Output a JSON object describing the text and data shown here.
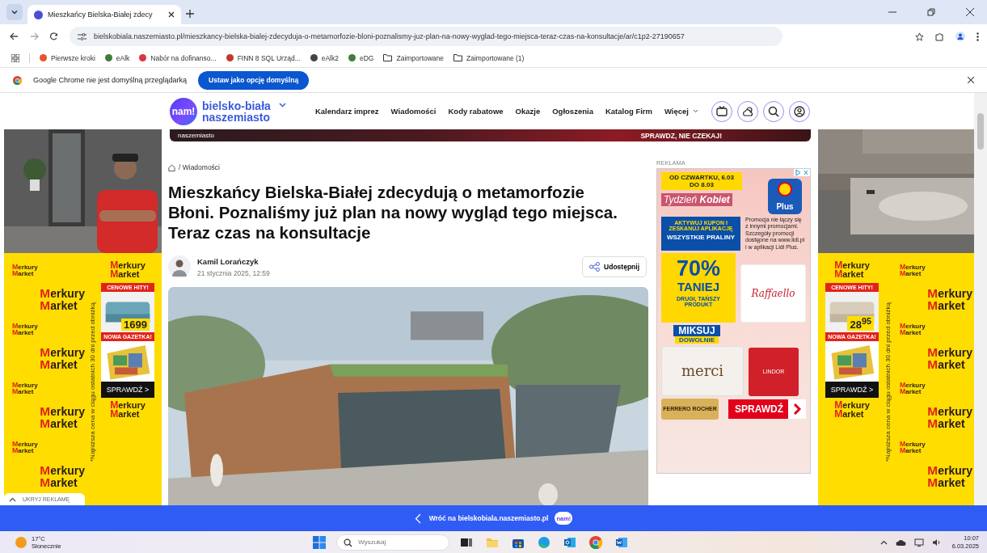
{
  "browser": {
    "tab_title": "Mieszkańcy Bielska-Białej zdecy",
    "url": "bielskobiala.naszemiasto.pl/mieszkancy-bielska-bialej-zdecyduja-o-metamorfozie-bloni-poznalismy-juz-plan-na-nowy-wyglad-tego-miejsca-teraz-czas-na-konsultacje/ar/c1p2-27190657",
    "bookmarks": [
      {
        "label": "Pierwsze kroki",
        "kind": "site",
        "color": "#e8542b"
      },
      {
        "label": "eAlk",
        "kind": "site",
        "color": "#3f7d3a"
      },
      {
        "label": "Nabór na dofinanso...",
        "kind": "site",
        "color": "#d9363e"
      },
      {
        "label": "FINN 8 SQL Urząd...",
        "kind": "site",
        "color": "#c0392b"
      },
      {
        "label": "eAlk2",
        "kind": "site",
        "color": "#444444"
      },
      {
        "label": "eDG",
        "kind": "site",
        "color": "#3f7d3a"
      },
      {
        "label": "Zaimportowane",
        "kind": "folder"
      },
      {
        "label": "Zaimportowane (1)",
        "kind": "folder"
      }
    ],
    "infobar": {
      "message": "Google Chrome nie jest domyślną przeglądarką",
      "button": "Ustaw jako opcję domyślną"
    }
  },
  "site": {
    "logo_badge": "nam!",
    "logo_line1": "bielsko-biała",
    "logo_line2": "naszemiasto",
    "nav": [
      {
        "label": "Kalendarz imprez",
        "dropdown": false
      },
      {
        "label": "Wiadomości",
        "dropdown": false
      },
      {
        "label": "Kody rabatowe",
        "dropdown": false
      },
      {
        "label": "Okazje",
        "dropdown": false
      },
      {
        "label": "Ogłoszenia",
        "dropdown": false
      },
      {
        "label": "Katalog Firm",
        "dropdown": false
      },
      {
        "label": "Więcej",
        "dropdown": true
      }
    ],
    "banner": {
      "brand": "naszemiasto",
      "cta": "SPRAWDZ, NIE CZEKAJ!"
    }
  },
  "article": {
    "breadcrumb": "/ Wiadomości",
    "title": "Mieszkańcy Bielska-Białej zdecydują o metamorfozie Błoni. Poznaliśmy już plan na nowy wygląd tego miejsca. Teraz czas na konsultacje",
    "author": "Kamil Lorańczyk",
    "date": "21 stycznia 2025, 12:59",
    "share": "Udostępnij"
  },
  "right_ad": {
    "label": "REKLAMA",
    "dates": "OD CZWARTKU, 6.03 DO 8.03",
    "headline": "Tydzień **Kobiet**",
    "app": "Plus",
    "coupon": "AKTYWUJ KUPON I ZESKANUJ APLIKACJĘ",
    "offer": "WSZYSTKIE PRALINY",
    "discount": "70%",
    "discount_word": "TANIEJ",
    "condition": "DRUGI, TAŃSZY PRODUKT",
    "mix": "MIKSUJ",
    "mix_sub": "DOWOLNIE",
    "terms": "Promocja nie łączy się z innymi promocjami. Szczegóły promocji dostępne na www.lidl.pl i w aplikacji Lidl Plus.",
    "products": [
      {
        "name": "Raffaello",
        "color": "#ffffff"
      },
      {
        "name": "merci",
        "color": "#f4f1ec"
      },
      {
        "name": "LINDOR",
        "color": "#d0202a"
      },
      {
        "name": "FERRERO ROCHER",
        "color": "#d8b15a"
      }
    ],
    "cta": "SPRAWDŹ"
  },
  "side_ads": [
    {
      "logos": [
        {
          "kind": "small",
          "lines": [
            "Merkury",
            "Market"
          ]
        },
        {
          "kind": "large",
          "lines": [
            "Merkury",
            "Market"
          ]
        },
        {
          "kind": "small",
          "lines": [
            "Merkury",
            "Market"
          ]
        },
        {
          "kind": "large",
          "lines": [
            "Merkury",
            "Market"
          ]
        },
        {
          "kind": "small",
          "lines": [
            "Merkury",
            "Market"
          ]
        },
        {
          "kind": "large",
          "lines": [
            "Merkury",
            "Market"
          ]
        },
        {
          "kind": "small",
          "lines": [
            "Merkury",
            "Market"
          ]
        },
        {
          "kind": "large",
          "lines": [
            "Merkury",
            "Market"
          ]
        }
      ],
      "promo": {
        "logo_top": [
          "Merkury",
          "Market"
        ],
        "tag1": "CENOWE HITY!",
        "price": "1699",
        "tag2": "NOWA GAZETKA!",
        "cta": "SPRAWDŹ >",
        "logo_bottom": [
          "Merkury",
          "Market"
        ]
      },
      "footnote": "*Najniższa cena w ciągu ostatnich 30 dni przed obniżką"
    },
    {
      "logos": [
        {
          "kind": "small",
          "lines": [
            "Merkury",
            "Market"
          ]
        },
        {
          "kind": "large",
          "lines": [
            "Merkury",
            "Market"
          ]
        },
        {
          "kind": "small",
          "lines": [
            "Merkury",
            "Market"
          ]
        },
        {
          "kind": "large",
          "lines": [
            "Merkury",
            "Market"
          ]
        },
        {
          "kind": "small",
          "lines": [
            "Merkury",
            "Market"
          ]
        },
        {
          "kind": "large",
          "lines": [
            "Merkury",
            "Market"
          ]
        },
        {
          "kind": "small",
          "lines": [
            "Merkury",
            "Market"
          ]
        },
        {
          "kind": "large",
          "lines": [
            "Merkury",
            "Market"
          ]
        }
      ],
      "promo": {
        "logo_top": [
          "Merkury",
          "Market"
        ],
        "tag1": "CENOWE HITY!",
        "price": "28$^{95}$",
        "tag2": "NOWA GAZETKA!",
        "cta": "SPRAWDŹ >",
        "logo_bottom": [
          "Merkury",
          "Market"
        ]
      },
      "footnote": "*Najniższa cena w ciągu ostatnich 30 dni przed obniżką"
    }
  ],
  "hide_ads": "UKRYJ REKLAMĘ",
  "back_bar": {
    "label": "Wróć na bielskobiala.naszemiasto.pl",
    "badge": "nam!"
  },
  "taskbar": {
    "temperature": "17°C",
    "weather": "Słonecznie",
    "search_placeholder": "Wyszukaj",
    "time": "10:07",
    "date": "6.03.2025"
  }
}
